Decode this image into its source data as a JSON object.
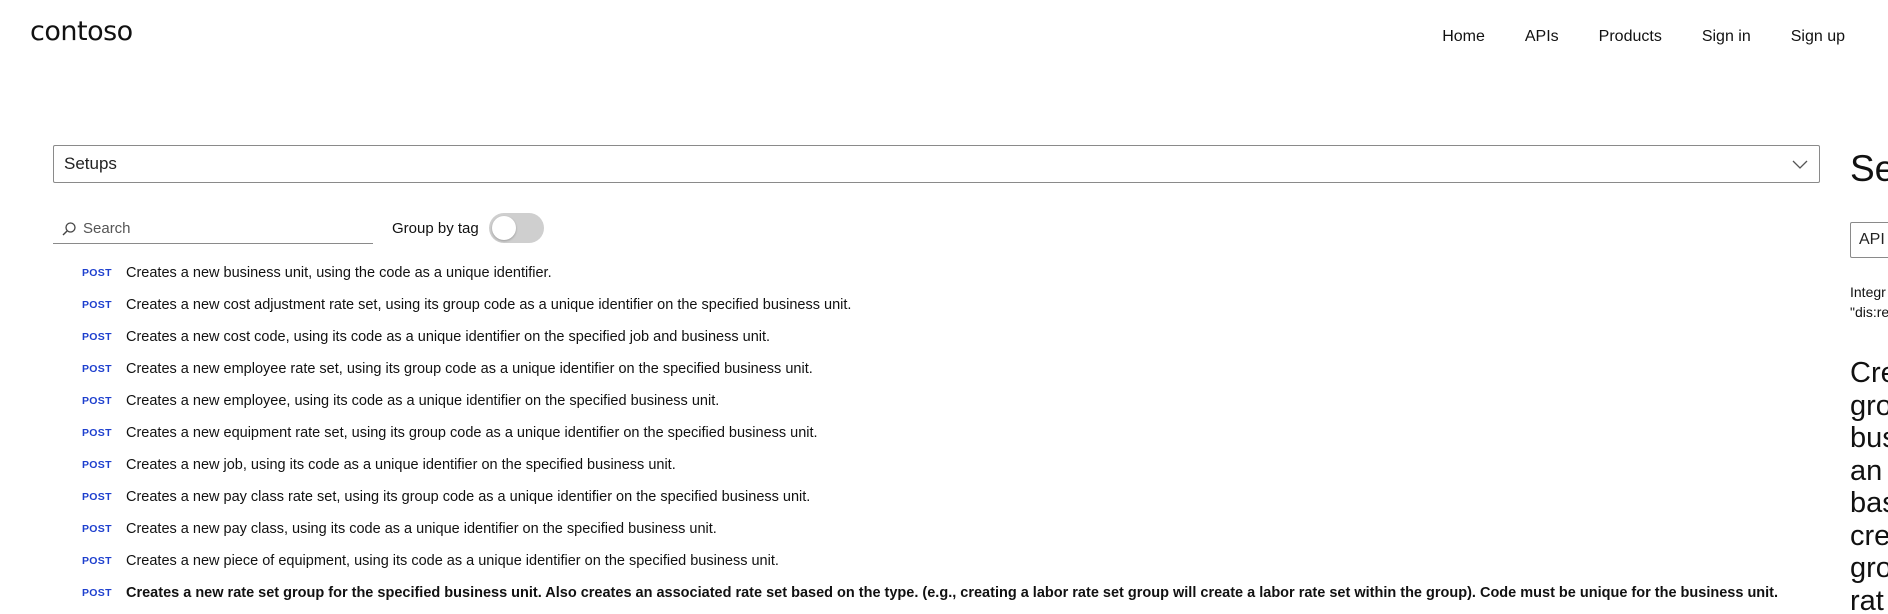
{
  "header": {
    "logo": "contoso",
    "nav": [
      "Home",
      "APIs",
      "Products",
      "Sign in",
      "Sign up"
    ]
  },
  "api_select": {
    "value": "Setups",
    "icon": "chevron-down-icon"
  },
  "search": {
    "placeholder": "Search",
    "value": "",
    "icon": "search-icon"
  },
  "group_by_tag": {
    "label": "Group by tag",
    "enabled": false
  },
  "operations": [
    {
      "method": "POST",
      "description": "Creates a new business unit, using the code as a unique identifier."
    },
    {
      "method": "POST",
      "description": "Creates a new cost adjustment rate set, using its group code as a unique identifier on the specified business unit."
    },
    {
      "method": "POST",
      "description": "Creates a new cost code, using its code as a unique identifier on the specified job and business unit."
    },
    {
      "method": "POST",
      "description": "Creates a new employee rate set, using its group code as a unique identifier on the specified business unit."
    },
    {
      "method": "POST",
      "description": "Creates a new employee, using its code as a unique identifier on the specified business unit."
    },
    {
      "method": "POST",
      "description": "Creates a new equipment rate set, using its group code as a unique identifier on the specified business unit."
    },
    {
      "method": "POST",
      "description": "Creates a new job, using its code as a unique identifier on the specified business unit."
    },
    {
      "method": "POST",
      "description": "Creates a new pay class rate set, using its group code as a unique identifier on the specified business unit."
    },
    {
      "method": "POST",
      "description": "Creates a new pay class, using its code as a unique identifier on the specified business unit."
    },
    {
      "method": "POST",
      "description": "Creates a new piece of equipment, using its code as a unique identifier on the specified business unit."
    },
    {
      "method": "POST",
      "description": "Creates a new rate set group for the specified business unit. Also creates an associated rate set based on the type. (e.g., creating a labor rate set group will create a labor rate set within the group). Code must be unique for the business unit.",
      "selected": true
    }
  ],
  "detail": {
    "title": "Se",
    "select_value": "API",
    "note_lines": [
      "Integr",
      "\"dis:re"
    ],
    "heading_lines": [
      "Cre",
      "gro",
      "bus",
      "an",
      "bas",
      "cre",
      "gro",
      "rat"
    ]
  },
  "colors": {
    "method_post": "#1d3fce",
    "toggle_off": "#cfcfcf",
    "border": "#8a8a8a"
  }
}
